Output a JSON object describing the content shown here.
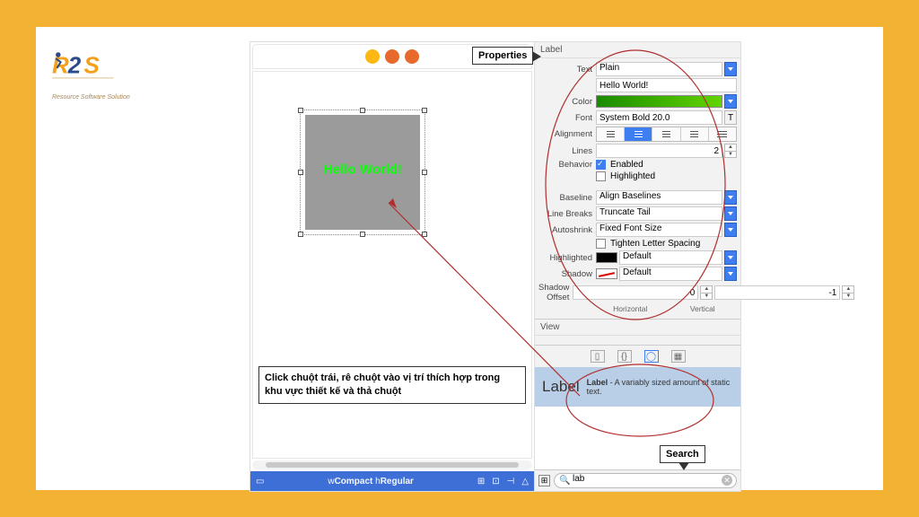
{
  "logo": {
    "tagline": "Resource Software Solution"
  },
  "callouts": {
    "properties": "Properties",
    "search": "Search",
    "instruction": "Click chuột trái, rê chuột vào vị trí thích hợp trong khu vực thiết kế và thả chuột"
  },
  "canvas": {
    "element_text": "Hello World!",
    "size_bar": {
      "w_label": "w",
      "w_value": "Compact",
      "h_label": "h",
      "h_value": "Regular"
    }
  },
  "inspector": {
    "section": "Label",
    "text_label": "Text",
    "text_type": "Plain",
    "text_value": "Hello World!",
    "color_label": "Color",
    "font_label": "Font",
    "font_value": "System Bold 20.0",
    "alignment_label": "Alignment",
    "lines_label": "Lines",
    "lines_value": "2",
    "behavior_label": "Behavior",
    "behavior_enabled": "Enabled",
    "behavior_highlighted": "Highlighted",
    "baseline_label": "Baseline",
    "baseline_value": "Align Baselines",
    "linebreaks_label": "Line Breaks",
    "linebreaks_value": "Truncate Tail",
    "autoshrink_label": "Autoshrink",
    "autoshrink_value": "Fixed Font Size",
    "tighten_label": "Tighten Letter Spacing",
    "highlighted_label": "Highlighted",
    "highlighted_value": "Default",
    "shadow_label": "Shadow",
    "shadow_value": "Default",
    "shadow_offset_label": "Shadow Offset",
    "shadow_offset_h": "0",
    "shadow_offset_v": "-1",
    "shadow_axis_h": "Horizontal",
    "shadow_axis_v": "Vertical",
    "view_section": "View"
  },
  "library": {
    "item_title": "Label",
    "item_desc_bold": "Label",
    "item_desc_rest": " - A variably sized amount of static text.",
    "filter_value": "lab"
  }
}
